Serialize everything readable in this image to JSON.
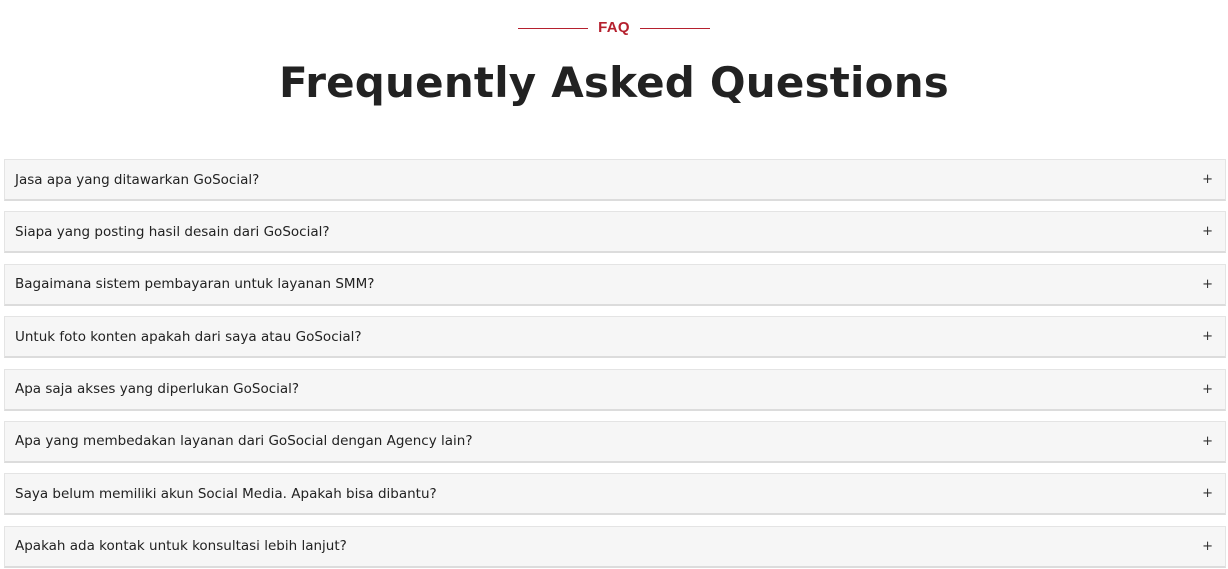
{
  "header": {
    "eyebrow": "FAQ",
    "title": "Frequently Asked Questions"
  },
  "faq": {
    "expand_icon": "+",
    "items": [
      {
        "question": "Jasa apa yang ditawarkan GoSocial?"
      },
      {
        "question": "Siapa yang posting hasil desain dari GoSocial?"
      },
      {
        "question": "Bagaimana sistem pembayaran untuk layanan SMM?"
      },
      {
        "question": "Untuk foto konten apakah dari saya atau GoSocial?"
      },
      {
        "question": "Apa saja akses yang diperlukan GoSocial?"
      },
      {
        "question": "Apa yang membedakan layanan dari GoSocial dengan Agency lain?"
      },
      {
        "question": "Saya belum memiliki akun Social Media. Apakah bisa dibantu?"
      },
      {
        "question": "Apakah ada kontak untuk konsultasi lebih lanjut?"
      }
    ]
  },
  "colors": {
    "accent": "#b5202e",
    "title": "#222222",
    "item_background": "#f6f6f6",
    "item_border": "#e4e4e4"
  }
}
